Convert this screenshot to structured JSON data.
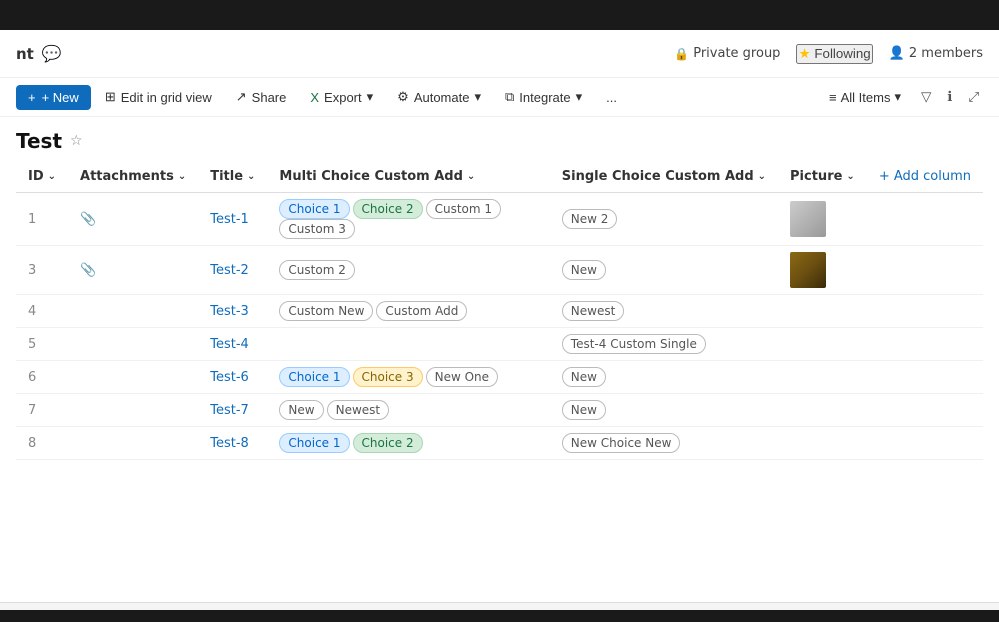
{
  "topBar": {},
  "appHeader": {
    "title": "nt",
    "iconLabel": "teams-icon",
    "privateGroup": "Private group",
    "following": "Following",
    "members": "2 members"
  },
  "toolbar": {
    "newLabel": "+ New",
    "editGridLabel": "Edit in grid view",
    "shareLabel": "Share",
    "exportLabel": "Export",
    "automateLabel": "Automate",
    "integrateLabel": "Integrate",
    "moreLabel": "...",
    "allItemsLabel": "All Items",
    "filterLabel": "filter",
    "infoLabel": "info",
    "expandLabel": "expand"
  },
  "listTitle": "Test",
  "table": {
    "columns": [
      {
        "key": "id",
        "label": "ID"
      },
      {
        "key": "attachments",
        "label": "Attachments"
      },
      {
        "key": "title",
        "label": "Title"
      },
      {
        "key": "multiChoice",
        "label": "Multi Choice Custom Add"
      },
      {
        "key": "singleChoice",
        "label": "Single Choice Custom Add"
      },
      {
        "key": "picture",
        "label": "Picture"
      }
    ],
    "addColumnLabel": "+ Add column",
    "rows": [
      {
        "id": "1",
        "hasAttachment": true,
        "title": "Test-1",
        "multiChoiceTags": [
          {
            "label": "Choice 1",
            "style": "blue"
          },
          {
            "label": "Choice 2",
            "style": "green"
          },
          {
            "label": "Custom 1",
            "style": "outline"
          },
          {
            "label": "Custom 3",
            "style": "outline"
          }
        ],
        "singleChoiceTags": [
          {
            "label": "New 2",
            "style": "outline"
          }
        ],
        "hasPicture": true,
        "pictureStyle": "gray"
      },
      {
        "id": "3",
        "hasAttachment": true,
        "title": "Test-2",
        "multiChoiceTags": [
          {
            "label": "Custom 2",
            "style": "outline"
          }
        ],
        "singleChoiceTags": [
          {
            "label": "New",
            "style": "outline"
          }
        ],
        "hasPicture": true,
        "pictureStyle": "brown"
      },
      {
        "id": "4",
        "hasAttachment": false,
        "title": "Test-3",
        "multiChoiceTags": [
          {
            "label": "Custom New",
            "style": "outline"
          },
          {
            "label": "Custom Add",
            "style": "outline"
          }
        ],
        "singleChoiceTags": [
          {
            "label": "Newest",
            "style": "outline"
          }
        ],
        "hasPicture": false,
        "pictureStyle": ""
      },
      {
        "id": "5",
        "hasAttachment": false,
        "title": "Test-4",
        "multiChoiceTags": [],
        "singleChoiceTags": [
          {
            "label": "Test-4 Custom Single",
            "style": "outline"
          }
        ],
        "hasPicture": false,
        "pictureStyle": ""
      },
      {
        "id": "6",
        "hasAttachment": false,
        "title": "Test-6",
        "multiChoiceTags": [
          {
            "label": "Choice 1",
            "style": "blue"
          },
          {
            "label": "Choice 3",
            "style": "yellow"
          },
          {
            "label": "New One",
            "style": "outline"
          }
        ],
        "singleChoiceTags": [
          {
            "label": "New",
            "style": "outline"
          }
        ],
        "hasPicture": false,
        "pictureStyle": ""
      },
      {
        "id": "7",
        "hasAttachment": false,
        "title": "Test-7",
        "multiChoiceTags": [
          {
            "label": "New",
            "style": "outline"
          },
          {
            "label": "Newest",
            "style": "outline"
          }
        ],
        "singleChoiceTags": [
          {
            "label": "New",
            "style": "outline"
          }
        ],
        "hasPicture": false,
        "pictureStyle": ""
      },
      {
        "id": "8",
        "hasAttachment": false,
        "title": "Test-8",
        "multiChoiceTags": [
          {
            "label": "Choice 1",
            "style": "blue"
          },
          {
            "label": "Choice 2",
            "style": "green"
          }
        ],
        "singleChoiceTags": [
          {
            "label": "New Choice New",
            "style": "outline"
          }
        ],
        "hasPicture": false,
        "pictureStyle": ""
      }
    ]
  }
}
